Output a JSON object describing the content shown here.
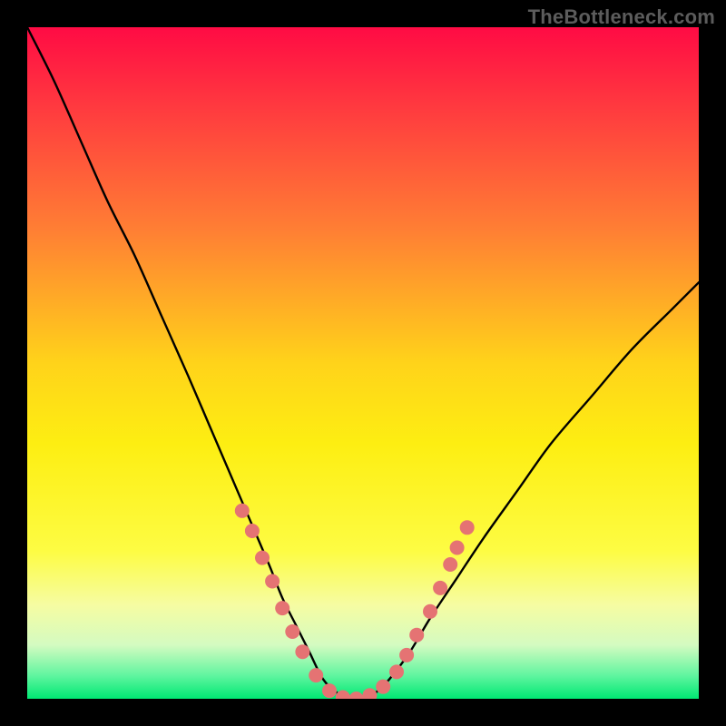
{
  "watermark": "TheBottleneck.com",
  "chart_data": {
    "type": "line",
    "title": "",
    "xlabel": "",
    "ylabel": "",
    "xlim": [
      0,
      100
    ],
    "ylim": [
      0,
      100
    ],
    "background_gradient": {
      "stops": [
        {
          "offset": 0.0,
          "color": "#ff0b44"
        },
        {
          "offset": 0.12,
          "color": "#ff3a3f"
        },
        {
          "offset": 0.3,
          "color": "#ff7e34"
        },
        {
          "offset": 0.5,
          "color": "#ffd31a"
        },
        {
          "offset": 0.62,
          "color": "#fdee12"
        },
        {
          "offset": 0.78,
          "color": "#fdfc43"
        },
        {
          "offset": 0.86,
          "color": "#f6fca2"
        },
        {
          "offset": 0.92,
          "color": "#d4fbc1"
        },
        {
          "offset": 0.965,
          "color": "#61f5a0"
        },
        {
          "offset": 1.0,
          "color": "#00e873"
        }
      ]
    },
    "series": [
      {
        "name": "bottleneck-curve",
        "color": "#000000",
        "x": [
          0,
          4,
          8,
          12,
          16,
          20,
          24,
          27,
          30,
          33,
          36,
          38,
          40,
          42,
          44,
          46,
          48,
          50,
          52,
          54,
          57,
          60,
          64,
          68,
          73,
          78,
          84,
          90,
          96,
          100
        ],
        "y": [
          100,
          92,
          83,
          74,
          66,
          57,
          48,
          41,
          34,
          27,
          20,
          15,
          11,
          7,
          3,
          1,
          0,
          0,
          1,
          3,
          7,
          12,
          18,
          24,
          31,
          38,
          45,
          52,
          58,
          62
        ]
      }
    ],
    "markers": {
      "name": "highlight-points",
      "color": "#e57373",
      "radius_px": 8,
      "points": [
        {
          "x": 32,
          "y": 28
        },
        {
          "x": 33.5,
          "y": 25
        },
        {
          "x": 35,
          "y": 21
        },
        {
          "x": 36.5,
          "y": 17.5
        },
        {
          "x": 38,
          "y": 13.5
        },
        {
          "x": 39.5,
          "y": 10
        },
        {
          "x": 41,
          "y": 7
        },
        {
          "x": 43,
          "y": 3.5
        },
        {
          "x": 45,
          "y": 1.2
        },
        {
          "x": 47,
          "y": 0.2
        },
        {
          "x": 49,
          "y": 0
        },
        {
          "x": 51,
          "y": 0.5
        },
        {
          "x": 53,
          "y": 1.8
        },
        {
          "x": 55,
          "y": 4
        },
        {
          "x": 56.5,
          "y": 6.5
        },
        {
          "x": 58,
          "y": 9.5
        },
        {
          "x": 60,
          "y": 13
        },
        {
          "x": 61.5,
          "y": 16.5
        },
        {
          "x": 63,
          "y": 20
        },
        {
          "x": 64,
          "y": 22.5
        },
        {
          "x": 65.5,
          "y": 25.5
        }
      ]
    }
  }
}
